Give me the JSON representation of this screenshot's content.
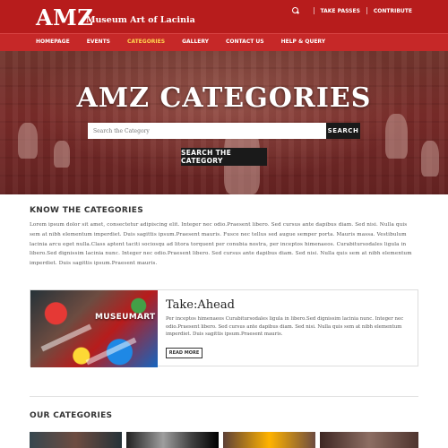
{
  "header": {
    "logo": "AMZ",
    "logo_subtitle": "Museum Art of Lacinia",
    "top_links": [
      "TAKE PASSES",
      "CONTRIBUTE"
    ],
    "accent_color": "#b71c1c"
  },
  "nav": {
    "items": [
      {
        "label": "HOMEPAGE",
        "active": false
      },
      {
        "label": "EVENTS",
        "active": false
      },
      {
        "label": "CATEGORIES",
        "active": true
      },
      {
        "label": "GALLERY",
        "active": false
      },
      {
        "label": "CONTACT US",
        "active": false
      },
      {
        "label": "HELP & QUERY",
        "active": false
      }
    ]
  },
  "hero": {
    "title": "AMZ CATEGORIES",
    "search_placeholder": "Search the Category",
    "search_button": "SEARCH",
    "category_button": "SEARCH THE CATEGORY"
  },
  "know": {
    "title": "KNOW THE CATEGORIES",
    "text": "Lorem ipsum dolor sit amet, consectetur adipiscing elit. Integer nec odio.Praesent libero. Sed cursus ante dapibus diam. Sed nisi. Nulla quis sem at nibh elementum imperdiet. Duis sagittis ipsum.Praesent mauris. Fusce nec tellus sed augue semper porta. Mauris massa. Vestibulum lacinia arcu eget nulla.Class aptent taciti sociosqu ad litora torquent per conubia nostra, per inceptos himenaeos. Curabitursodales ligula in libero.Sed dignissim lacinia nunc. Integer nec odio.Praesent libero. Sed cursus ante dapibus diam. Sed nisi. Nulla quis sem at nibh elementum imperdiet. Duis sagittis ipsum.Praesent mauris."
  },
  "card": {
    "image_label": "MUSEUMART",
    "title": "Take:Ahead",
    "text": "Per inceptos himenaeos Curabitursodales ligula in libero.Sed dignissim lacinia nunc. Integer nec odio.Praesent libero. Sed cursus ante dapibus diam. Sed nisi. Nulla quis sem at nibh elementum imperdiet. Duis sagittis ipsum.Praesent mauris.",
    "button": "READ MORE"
  },
  "our": {
    "title": "OUR CATEGORIES"
  }
}
